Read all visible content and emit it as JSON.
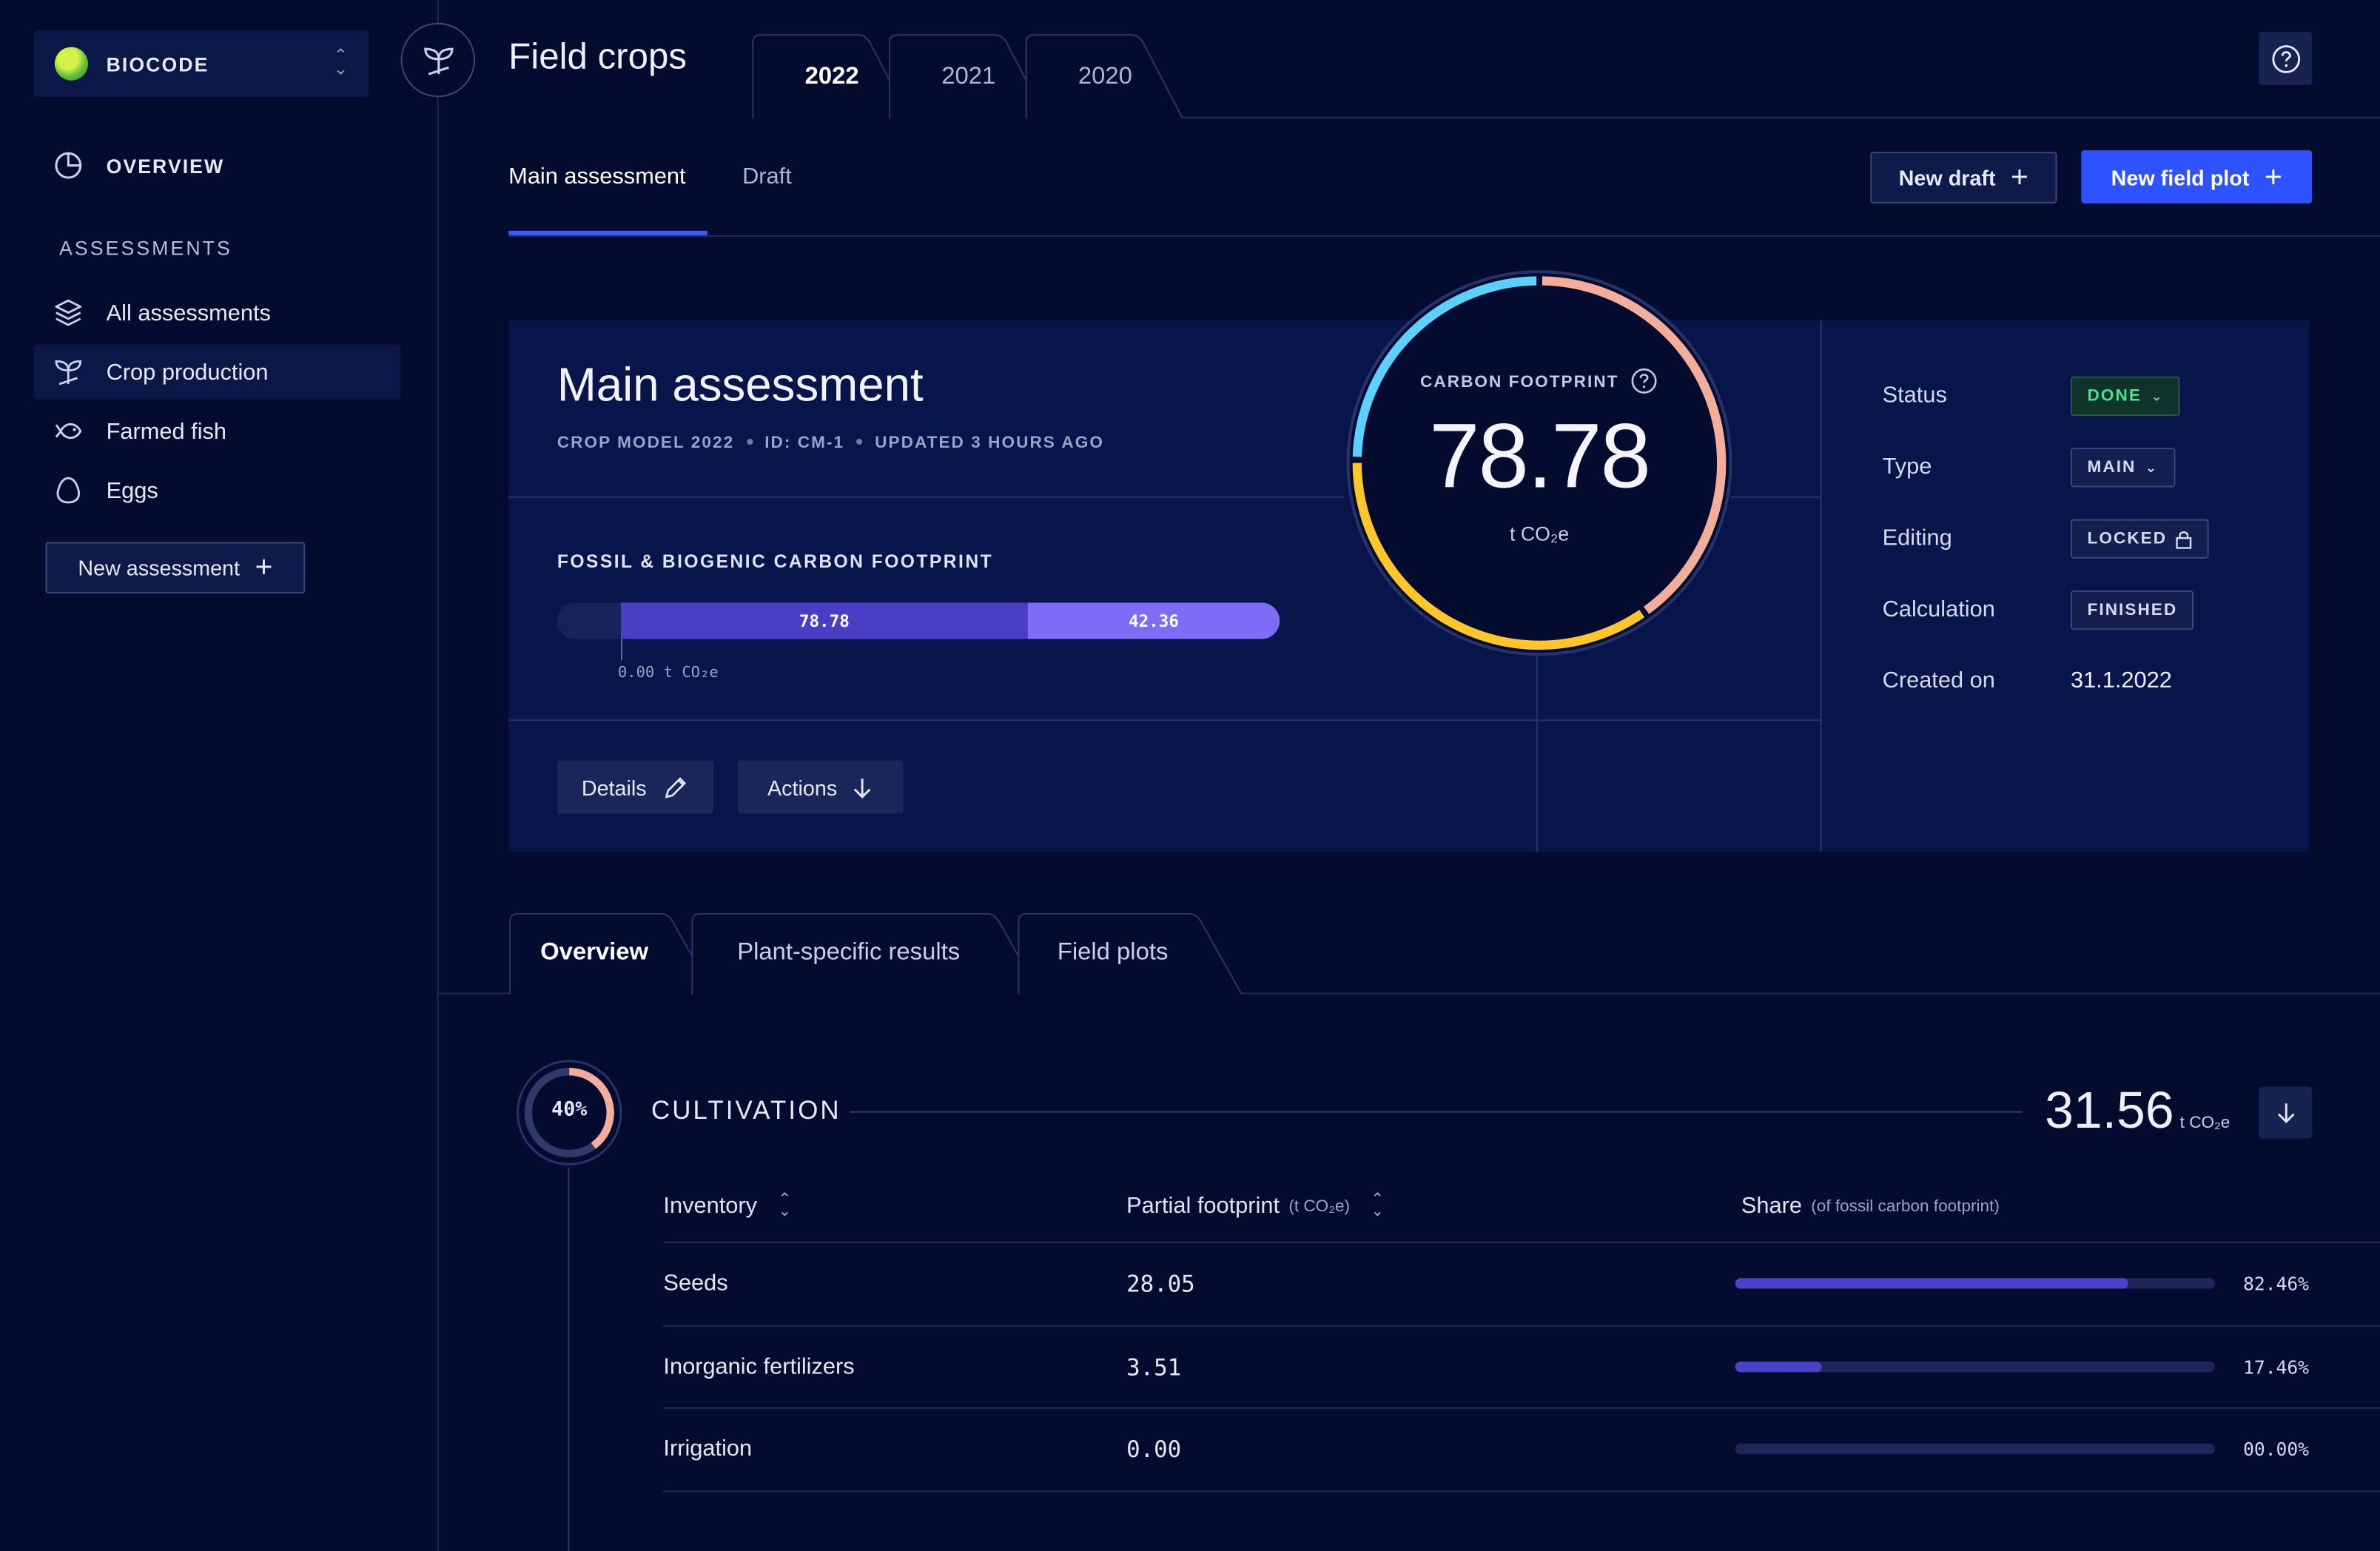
{
  "brand": {
    "name": "BIOCODE"
  },
  "sidebar": {
    "overview_label": "OVERVIEW",
    "section_label": "ASSESSMENTS",
    "items": [
      {
        "label": "All assessments"
      },
      {
        "label": "Crop production",
        "active": true
      },
      {
        "label": "Farmed fish"
      },
      {
        "label": "Eggs"
      }
    ],
    "new_assessment_label": "New assessment"
  },
  "header": {
    "title": "Field crops",
    "year_tabs": [
      "2022",
      "2021",
      "2020"
    ],
    "active_year": "2022"
  },
  "subtabs": {
    "main": "Main assessment",
    "draft": "Draft"
  },
  "actions": {
    "new_draft": "New draft",
    "new_field_plot": "New field plot"
  },
  "assessment": {
    "title": "Main assessment",
    "meta": [
      "CROP MODEL 2022",
      "ID: CM-1",
      "UPDATED 3 HOURS AGO"
    ],
    "footprint_label": "FOSSIL & BIOGENIC CARBON FOOTPRINT",
    "bar": {
      "fossil": "78.78",
      "biogenic": "42.36",
      "axis": "0.00 t CO₂e"
    },
    "details_label": "Details",
    "actions_label": "Actions",
    "gauge": {
      "label": "CARBON FOOTPRINT",
      "value": "78.78",
      "unit": "t CO₂e"
    }
  },
  "properties": {
    "status": {
      "label": "Status",
      "value": "DONE"
    },
    "type": {
      "label": "Type",
      "value": "MAIN"
    },
    "editing": {
      "label": "Editing",
      "value": "LOCKED"
    },
    "calculation": {
      "label": "Calculation",
      "value": "FINISHED"
    },
    "created": {
      "label": "Created on",
      "value": "31.1.2022"
    }
  },
  "bottom_tabs": [
    "Overview",
    "Plant-specific results",
    "Field plots"
  ],
  "cultivation": {
    "percent": "40%",
    "title": "CULTIVATION",
    "value": "31.56",
    "unit": "t CO₂e",
    "columns": {
      "inventory": "Inventory",
      "partial": "Partial footprint",
      "partial_unit": "(t CO₂e)",
      "share": "Share",
      "share_note": "(of fossil carbon footprint)"
    },
    "rows": [
      {
        "name": "Seeds",
        "partial": "28.05",
        "share": "82.46%"
      },
      {
        "name": "Inorganic fertilizers",
        "partial": "3.51",
        "share": "17.46%"
      },
      {
        "name": "Irrigation",
        "partial": "0.00",
        "share": "00.00%"
      }
    ],
    "share_fractions": [
      0.82,
      0.18,
      0.0
    ]
  },
  "colors": {
    "accent": "#2f52ff",
    "gauge_blue": "#5ad1ff",
    "gauge_salmon": "#f4ad9b",
    "gauge_yellow": "#ffc62b",
    "bar_fossil": "#4a3fc4",
    "bar_biogenic": "#7e6cf6",
    "done": "#4be38a"
  }
}
